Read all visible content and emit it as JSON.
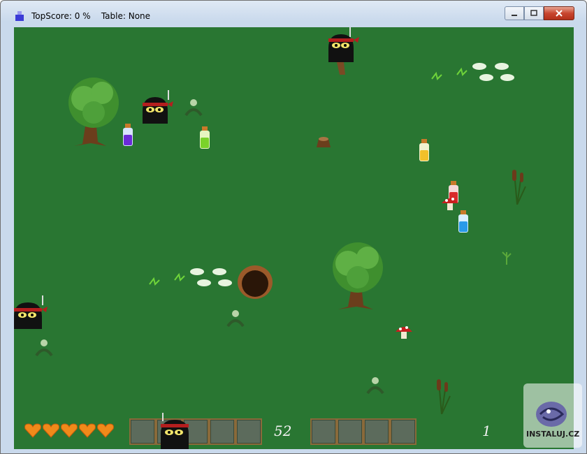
{
  "window": {
    "title": "TopScore: 0 %    Table: None",
    "controls": [
      "minimize",
      "maximize",
      "close"
    ]
  },
  "hud": {
    "hearts": 5,
    "score": "52",
    "level": "1"
  },
  "watermark": {
    "text": "INSTALUJ.CZ"
  },
  "colors": {
    "grass": "#297632",
    "hud_box": "#5c6b5c",
    "hud_border": "#8a6a3a"
  }
}
